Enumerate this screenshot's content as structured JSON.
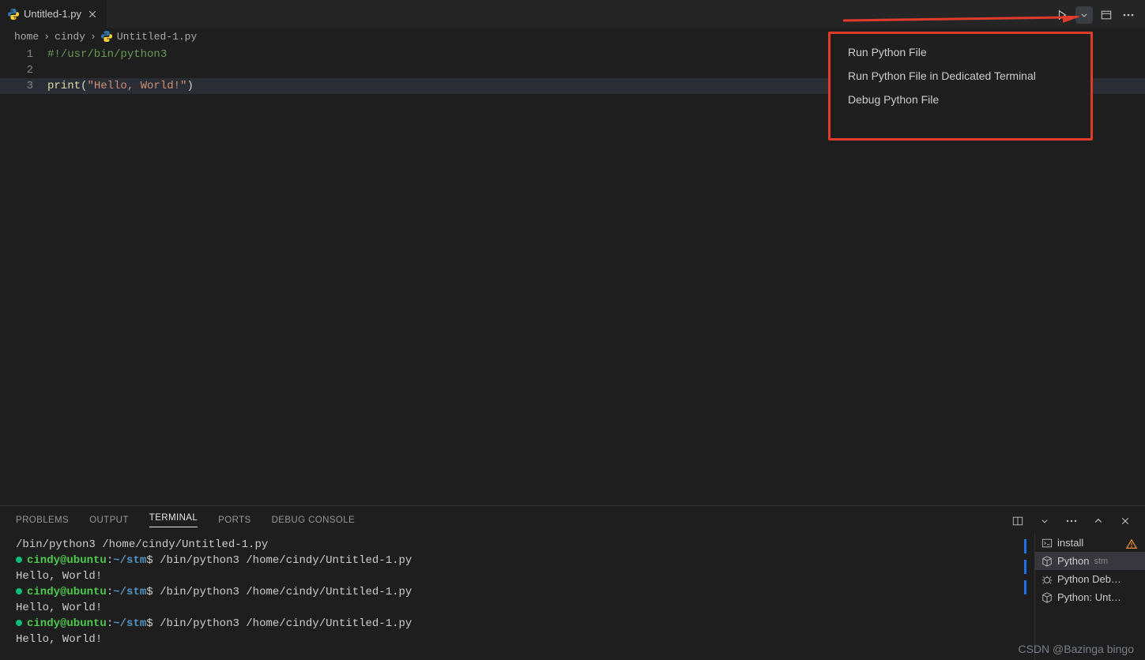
{
  "tab": {
    "title": "Untitled-1.py"
  },
  "breadcrumbs": {
    "a": "home",
    "b": "cindy",
    "c": "Untitled-1.py"
  },
  "code": {
    "l1": "#!/usr/bin/python3",
    "l3_fn": "print",
    "l3_str": "\"Hello, World!\""
  },
  "run_menu": {
    "items": [
      "Run Python File",
      "Run Python File in Dedicated Terminal",
      "Debug Python File"
    ]
  },
  "panel": {
    "tabs": {
      "problems": "PROBLEMS",
      "output": "OUTPUT",
      "terminal": "TERMINAL",
      "ports": "PORTS",
      "debug": "DEBUG CONSOLE"
    },
    "terminal": {
      "line0": "/bin/python3 /home/cindy/Untitled-1.py",
      "prompt_user": "cindy@ubuntu",
      "prompt_path": "~/stm",
      "cmd": "/bin/python3 /home/cindy/Untitled-1.py",
      "out": "Hello, World!"
    },
    "side": {
      "items": [
        {
          "label": "install"
        },
        {
          "label": "Python",
          "note": "stm"
        },
        {
          "label": "Python Deb…"
        },
        {
          "label": "Python: Unt…"
        }
      ]
    }
  },
  "watermark": "CSDN @Bazinga bingo"
}
